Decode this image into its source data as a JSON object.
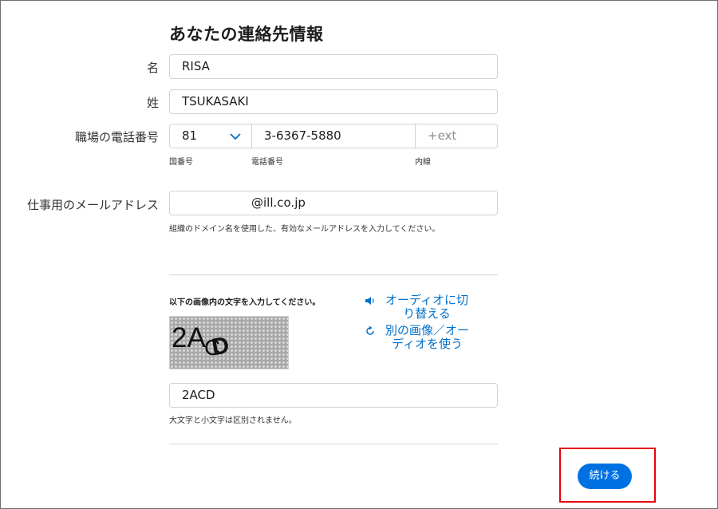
{
  "page": {
    "title": "あなたの連絡先情報"
  },
  "form": {
    "first_name": {
      "label": "名",
      "value": "RISA"
    },
    "last_name": {
      "label": "姓",
      "value": "TSUKASAKI"
    },
    "phone": {
      "label": "職場の電話番号",
      "country_code": "81",
      "number": "3-6367-5880",
      "ext_placeholder": "+ext",
      "country_code_hint": "国番号",
      "number_hint": "電話番号",
      "ext_hint": "内線"
    },
    "email": {
      "label": "仕事用のメールアドレス",
      "value_suffix": "@ill.co.jp",
      "hint": "組織のドメイン名を使用した、有効なメールアドレスを入力してください。"
    }
  },
  "captcha": {
    "instruction": "以下の画像内の文字を入力してください。",
    "image_text": "2ACD",
    "audio_link": "オーディオに切\nり替える",
    "new_image_link": "別の画像／オー\nディオを使う",
    "input_value": "2ACD",
    "case_hint": "大文字と小文字は区別されません。"
  },
  "actions": {
    "continue_label": "続ける"
  },
  "colors": {
    "accent": "#0071e3",
    "link": "#0070c9",
    "highlight_border": "#e8000d"
  },
  "icons": {
    "dropdown": "chevron-down-icon",
    "audio": "speaker-icon",
    "refresh": "refresh-icon"
  }
}
